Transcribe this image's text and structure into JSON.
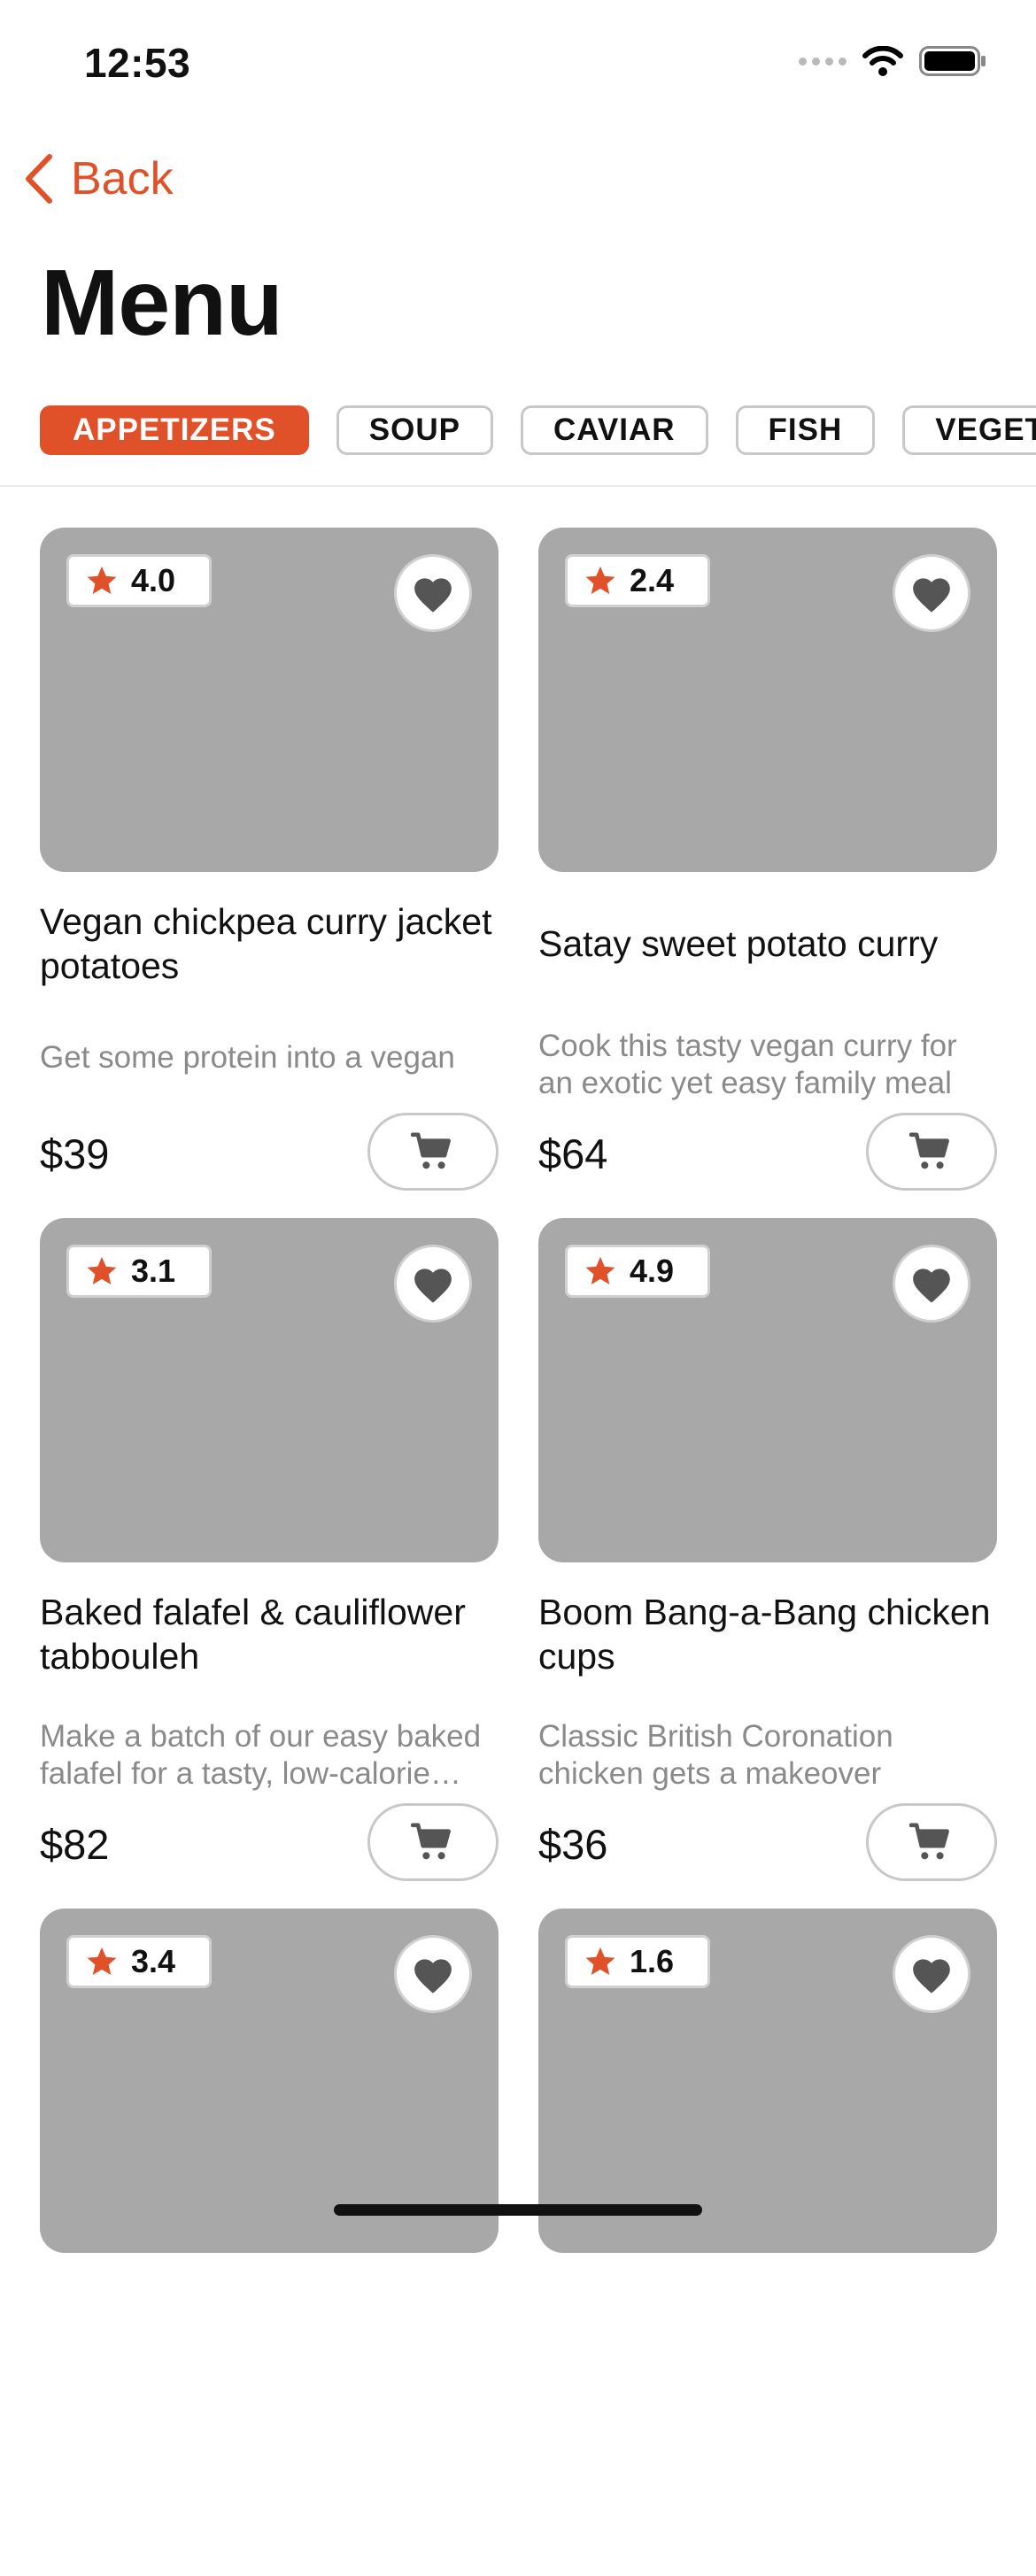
{
  "status_bar": {
    "time": "12:53"
  },
  "nav": {
    "back_label": "Back",
    "title": "Menu"
  },
  "categories": [
    "APPETIZERS",
    "SOUP",
    "CAVIAR",
    "FISH",
    "VEGET"
  ],
  "active_category": "APPETIZERS",
  "colors": {
    "accent": "#E0512A",
    "image_placeholder": "#A8A8A8",
    "icon_dark": "#555555",
    "muted_text": "#8A8A8A"
  },
  "items": [
    {
      "rating": "4.0",
      "title": "Vegan chickpea curry jacket potatoes",
      "description": "Get some protein into a vegan",
      "price": "$39"
    },
    {
      "rating": "2.4",
      "title": "Satay sweet potato curry",
      "description": "Cook this tasty vegan curry for an exotic yet easy family meal",
      "price": "$64"
    },
    {
      "rating": "3.1",
      "title": "Baked falafel & cauliflower tabbouleh",
      "description": "Make a batch of our easy baked falafel for a tasty, low-calorie lunch",
      "price": "$82"
    },
    {
      "rating": "4.9",
      "title": "Boom Bang-a-Bang chicken cups",
      "description": "Classic British Coronation chicken gets a makeover",
      "price": "$36"
    },
    {
      "rating": "3.4"
    },
    {
      "rating": "1.6"
    }
  ],
  "icons": {
    "back": "chevron-left-icon",
    "rating": "star-icon",
    "favorite": "heart-icon",
    "cart": "cart-icon"
  }
}
